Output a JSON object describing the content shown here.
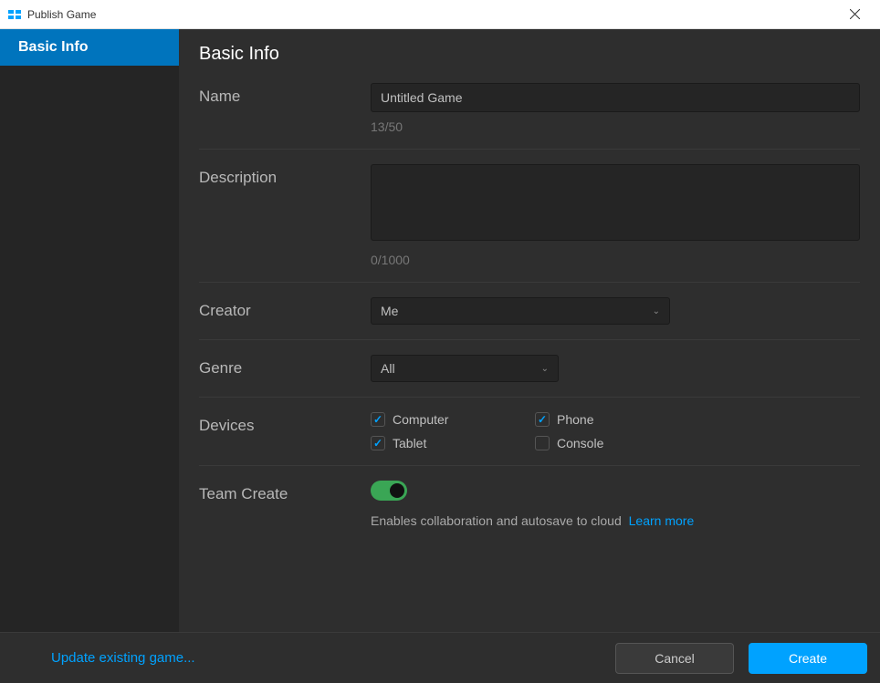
{
  "titlebar": {
    "title": "Publish Game"
  },
  "sidebar": {
    "items": [
      {
        "label": "Basic Info",
        "active": true
      }
    ]
  },
  "content": {
    "heading": "Basic Info",
    "fields": {
      "name": {
        "label": "Name",
        "value": "Untitled Game",
        "counter": "13/50"
      },
      "description": {
        "label": "Description",
        "value": "",
        "counter": "0/1000"
      },
      "creator": {
        "label": "Creator",
        "value": "Me"
      },
      "genre": {
        "label": "Genre",
        "value": "All"
      },
      "devices": {
        "label": "Devices",
        "options": [
          {
            "label": "Computer",
            "checked": true
          },
          {
            "label": "Phone",
            "checked": true
          },
          {
            "label": "Tablet",
            "checked": true
          },
          {
            "label": "Console",
            "checked": false
          }
        ]
      },
      "team_create": {
        "label": "Team Create",
        "enabled": true,
        "helper": "Enables collaboration and autosave to cloud",
        "link": "Learn more"
      }
    }
  },
  "footer": {
    "update_link": "Update existing game...",
    "cancel": "Cancel",
    "create": "Create"
  }
}
